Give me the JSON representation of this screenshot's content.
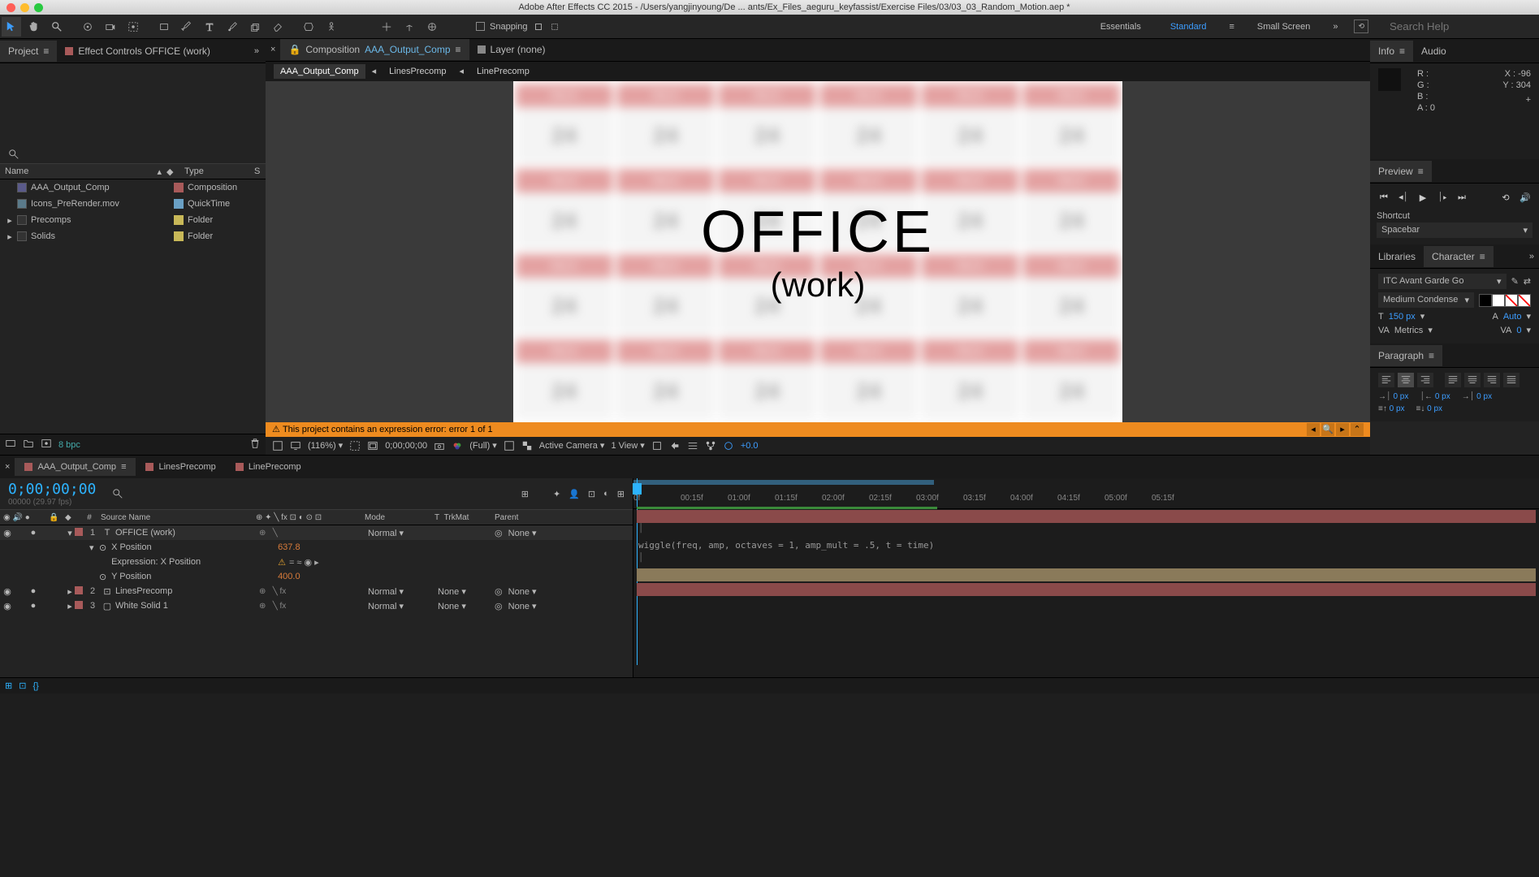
{
  "app": {
    "title": "Adobe After Effects CC 2015 - /Users/yangjinyoung/De ... ants/Ex_Files_aeguru_keyfassist/Exercise Files/03/03_03_Random_Motion.aep *"
  },
  "toolbar": {
    "snapping_label": "Snapping"
  },
  "workspaces": {
    "essentials": "Essentials",
    "standard": "Standard",
    "small": "Small Screen",
    "search_placeholder": "Search Help"
  },
  "left": {
    "project_tab": "Project",
    "fx_tab": "Effect Controls OFFICE (work)",
    "header_name": "Name",
    "header_type": "Type",
    "header_s": "S",
    "rows": [
      {
        "name": "AAA_Output_Comp",
        "type": "Composition",
        "color": "#a85a5a",
        "icon": "comp"
      },
      {
        "name": "Icons_PreRender.mov",
        "type": "QuickTime",
        "color": "#6aa0c4",
        "icon": "mov"
      },
      {
        "name": "Precomps",
        "type": "Folder",
        "color": "#c8b858",
        "icon": "folder",
        "tw": "▸"
      },
      {
        "name": "Solids",
        "type": "Folder",
        "color": "#c8b858",
        "icon": "folder",
        "tw": "▸"
      }
    ],
    "bpc": "8 bpc"
  },
  "center": {
    "comp_tab_prefix": "Composition",
    "comp_tab_name": "AAA_Output_Comp",
    "layer_tab": "Layer (none)",
    "breadcrumb": [
      "AAA_Output_Comp",
      "LinesPrecomp",
      "LinePrecomp"
    ],
    "canvas": {
      "main_text": "OFFICE",
      "sub_text": "(work)",
      "cal_month": "March",
      "cal_day": "24"
    },
    "error": "This project contains an expression error: error 1 of 1",
    "footer": {
      "zoom": "(116%)",
      "time": "0;00;00;00",
      "res": "(Full)",
      "camera": "Active Camera",
      "view": "1 View",
      "exposure": "+0.0"
    }
  },
  "right": {
    "info_tab": "Info",
    "audio_tab": "Audio",
    "info": {
      "r": "R :",
      "g": "G :",
      "b": "B :",
      "a": "A :  0",
      "x": "X : -96",
      "y": "Y : 304"
    },
    "preview_tab": "Preview",
    "shortcut_label": "Shortcut",
    "shortcut_value": "Spacebar",
    "lib_tab": "Libraries",
    "char_tab": "Character",
    "char": {
      "font": "ITC Avant Garde Go",
      "style": "Medium Condense",
      "size": "150 px",
      "leading": "Auto",
      "kerning": "Metrics",
      "tracking": "0"
    },
    "para_tab": "Paragraph",
    "para": {
      "indent": "0 px"
    }
  },
  "timeline": {
    "tabs": [
      "AAA_Output_Comp",
      "LinesPrecomp",
      "LinePrecomp"
    ],
    "timecode": "0;00;00;00",
    "timecode_sub": "00000 (29.97 fps)",
    "header": {
      "source": "Source Name",
      "mode": "Mode",
      "t": "T",
      "trkmat": "TrkMat",
      "parent": "Parent",
      "num": "#"
    },
    "layers": [
      {
        "num": "1",
        "name": "OFFICE (work)",
        "color": "#a85a5a",
        "mode": "Normal",
        "trk": "",
        "parent": "None",
        "open": true,
        "text": true
      },
      {
        "num": "2",
        "name": "LinesPrecomp",
        "color": "#a85a5a",
        "mode": "Normal",
        "trk": "None",
        "parent": "None",
        "icon": "comp",
        "fx": true
      },
      {
        "num": "3",
        "name": "White Solid 1",
        "color": "#a85a5a",
        "mode": "Normal",
        "trk": "None",
        "parent": "None",
        "icon": "solid",
        "fx": true
      }
    ],
    "props": {
      "xpos_label": "X Position",
      "xpos_val": "637.8",
      "expr_label": "Expression: X Position",
      "ypos_label": "Y Position",
      "ypos_val": "400.0",
      "expr_text": "wiggle(freq, amp, octaves = 1, amp_mult = .5, t = time)"
    },
    "ruler": [
      "0f",
      "00:15f",
      "01:00f",
      "01:15f",
      "02:00f",
      "02:15f",
      "03:00f",
      "03:15f",
      "04:00f",
      "04:15f",
      "05:00f",
      "05:15f"
    ]
  }
}
